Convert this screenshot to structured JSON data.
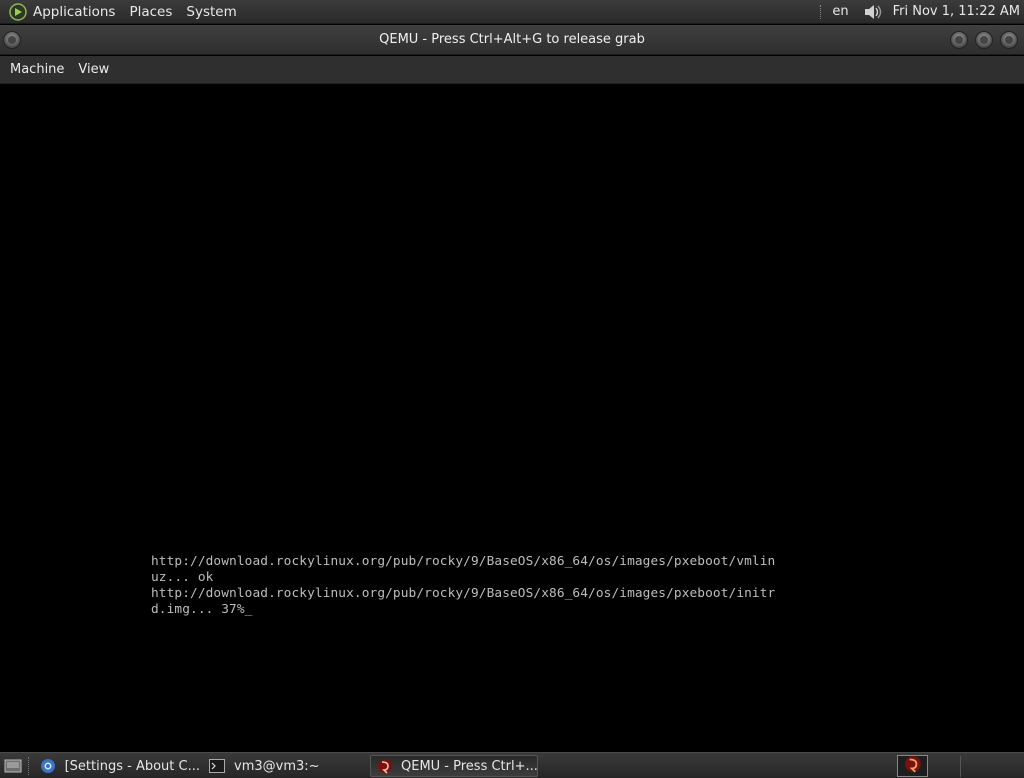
{
  "top_panel": {
    "menus": [
      "Applications",
      "Places",
      "System"
    ],
    "language": "en",
    "clock": "Fri Nov  1, 11:22 AM"
  },
  "window": {
    "title": "QEMU - Press Ctrl+Alt+G to release grab"
  },
  "menubar": {
    "items": [
      "Machine",
      "View"
    ]
  },
  "console": {
    "lines": [
      "http://download.rockylinux.org/pub/rocky/9/BaseOS/x86_64/os/images/pxeboot/vmlin",
      "uz... ok",
      "http://download.rockylinux.org/pub/rocky/9/BaseOS/x86_64/os/images/pxeboot/initr",
      "d.img... 37%"
    ],
    "cursor": "_"
  },
  "taskbar": {
    "tasks": [
      {
        "label": "[Settings - About C...",
        "icon": "browser-icon"
      },
      {
        "label": "vm3@vm3:~",
        "icon": "terminal-icon"
      },
      {
        "label": "QEMU - Press Ctrl+...",
        "icon": "qemu-icon",
        "active": true
      }
    ]
  },
  "colors": {
    "panel_bg": "#2f2f2f",
    "console_text": "#bdbdbd",
    "screen_bg": "#000000"
  }
}
